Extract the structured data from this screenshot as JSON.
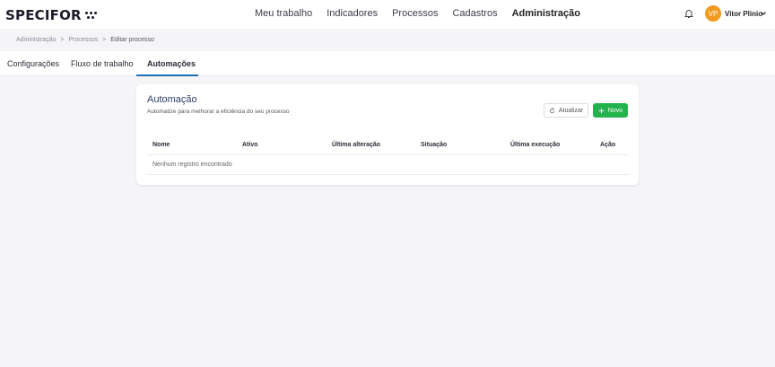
{
  "brand": {
    "name": "SPECIFOR"
  },
  "nav": {
    "items": [
      {
        "label": "Meu trabalho",
        "active": false
      },
      {
        "label": "Indicadores",
        "active": false
      },
      {
        "label": "Processos",
        "active": false
      },
      {
        "label": "Cadastros",
        "active": false
      },
      {
        "label": "Administração",
        "active": true
      }
    ]
  },
  "user": {
    "initials": "VP",
    "name": "Vitor Plinio",
    "avatar_color": "#f39a1f"
  },
  "breadcrumb": {
    "items": [
      "Administração",
      "Processos",
      "Editar processo"
    ],
    "separator": ">"
  },
  "tabs": [
    {
      "label": "Configurações",
      "active": false
    },
    {
      "label": "Fluxo de trabalho",
      "active": false
    },
    {
      "label": "Automações",
      "active": true
    }
  ],
  "card": {
    "title": "Automação",
    "subtitle": "Automatize para melhorar a eficiência do seu processo",
    "refresh_label": "Atualizar",
    "new_label": "Novo"
  },
  "table": {
    "columns": [
      "Nome",
      "Ativo",
      "Última alteração",
      "Situação",
      "Última execução",
      "Ação"
    ],
    "empty_message": "Nenhum registro encontrado",
    "rows": []
  },
  "colors": {
    "accent": "#1f6fb2",
    "primary_button": "#23b24b",
    "background": "#f5f5f8"
  }
}
